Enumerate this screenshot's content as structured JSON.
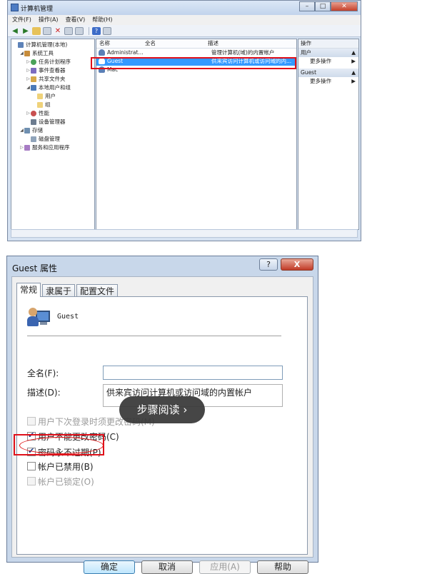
{
  "cm": {
    "title": "计算机管理",
    "menu": [
      "文件(F)",
      "操作(A)",
      "查看(V)",
      "帮助(H)"
    ],
    "tree": [
      {
        "label": "计算机管理(本地)",
        "depth": 0,
        "icon": "computer-icon",
        "exp": ""
      },
      {
        "label": "系统工具",
        "depth": 1,
        "icon": "tools-icon",
        "exp": "◢"
      },
      {
        "label": "任务计划程序",
        "depth": 2,
        "icon": "clock-icon",
        "exp": "▷"
      },
      {
        "label": "事件查看器",
        "depth": 2,
        "icon": "event-icon",
        "exp": "▷"
      },
      {
        "label": "共享文件夹",
        "depth": 2,
        "icon": "share-icon",
        "exp": "▷"
      },
      {
        "label": "本地用户和组",
        "depth": 2,
        "icon": "users-icon",
        "exp": "◢"
      },
      {
        "label": "用户",
        "depth": 3,
        "icon": "folder-icon",
        "exp": ""
      },
      {
        "label": "组",
        "depth": 3,
        "icon": "folder-icon",
        "exp": ""
      },
      {
        "label": "性能",
        "depth": 2,
        "icon": "performance-icon",
        "exp": "▷"
      },
      {
        "label": "设备管理器",
        "depth": 2,
        "icon": "device-manager-icon",
        "exp": ""
      },
      {
        "label": "存储",
        "depth": 1,
        "icon": "storage-icon",
        "exp": "◢"
      },
      {
        "label": "磁盘管理",
        "depth": 2,
        "icon": "disk-icon",
        "exp": ""
      },
      {
        "label": "服务和应用程序",
        "depth": 1,
        "icon": "services-icon",
        "exp": "▷"
      }
    ],
    "list_headers": {
      "name": "名称",
      "fullname": "全名",
      "desc": "描述"
    },
    "list_rows": [
      {
        "name": "Administrat...",
        "fullname": "",
        "desc": "管理计算机(域)的内置帐户"
      },
      {
        "name": "Guest",
        "fullname": "",
        "desc": "供来宾访问计算机或访问域的内..."
      },
      {
        "name": "Mac",
        "fullname": "",
        "desc": ""
      }
    ],
    "actions": {
      "header": "操作",
      "group1": "用户",
      "group1_item": "更多操作",
      "group2": "Guest",
      "group2_item": "更多操作"
    }
  },
  "gp": {
    "title": "Guest 属性",
    "help_btn": "?",
    "close_btn": "X",
    "tabs": [
      "常规",
      "隶属于",
      "配置文件"
    ],
    "username": "Guest",
    "fullname_label": "全名(F):",
    "fullname_value": "",
    "desc_label": "描述(D):",
    "desc_value": "供来宾访问计算机或访问域的内置帐户",
    "checkboxes": [
      {
        "label": "用户下次登录时须更改密码(M)",
        "checked": false,
        "disabled": true
      },
      {
        "label": "用户不能更改密码(C)",
        "checked": true,
        "disabled": false
      },
      {
        "label": "密码永不过期(P)",
        "checked": true,
        "disabled": false
      },
      {
        "label": "帐户已禁用(B)",
        "checked": false,
        "disabled": false
      },
      {
        "label": "帐户已锁定(O)",
        "checked": false,
        "disabled": true
      }
    ],
    "buttons": {
      "ok": "确定",
      "cancel": "取消",
      "apply": "应用(A)",
      "help": "帮助"
    }
  },
  "overlay": {
    "step_read": "步骤阅读 ›"
  },
  "colors": {
    "highlight": "#e01010",
    "selection": "#3399ff"
  }
}
